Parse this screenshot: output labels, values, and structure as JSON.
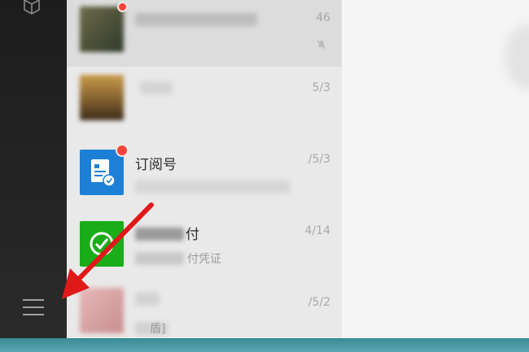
{
  "colors": {
    "sidebar_bg": "#1d1d1d",
    "list_bg": "#e9e9e9",
    "accent_red": "#e01818",
    "notify_dot": "#f44336",
    "subscription_blue": "#1e7fd6",
    "pay_green": "#1aad19"
  },
  "sidebar": {
    "top_icon": "cube-icon",
    "menu_icon": "hamburger-menu-icon"
  },
  "chats": [
    {
      "title": "",
      "subtitle": "",
      "time": "46",
      "muted": true,
      "icon": "blurred-avatar"
    },
    {
      "title": "",
      "subtitle": "",
      "time": "5/3",
      "icon": "blurred-avatar"
    },
    {
      "title": "订阅号",
      "subtitle": "",
      "time": "/5/3",
      "icon": "subscription-icon",
      "unread_dot": true
    },
    {
      "title": "付",
      "subtitle": "付凭证",
      "time": "4/14",
      "icon": "wechat-pay-icon"
    },
    {
      "title": "",
      "subtitle": "盾]",
      "time": "/5/2",
      "icon": "blurred-avatar"
    }
  ],
  "annotation": {
    "type": "arrow",
    "color": "#e01818",
    "target": "hamburger-menu-icon"
  }
}
